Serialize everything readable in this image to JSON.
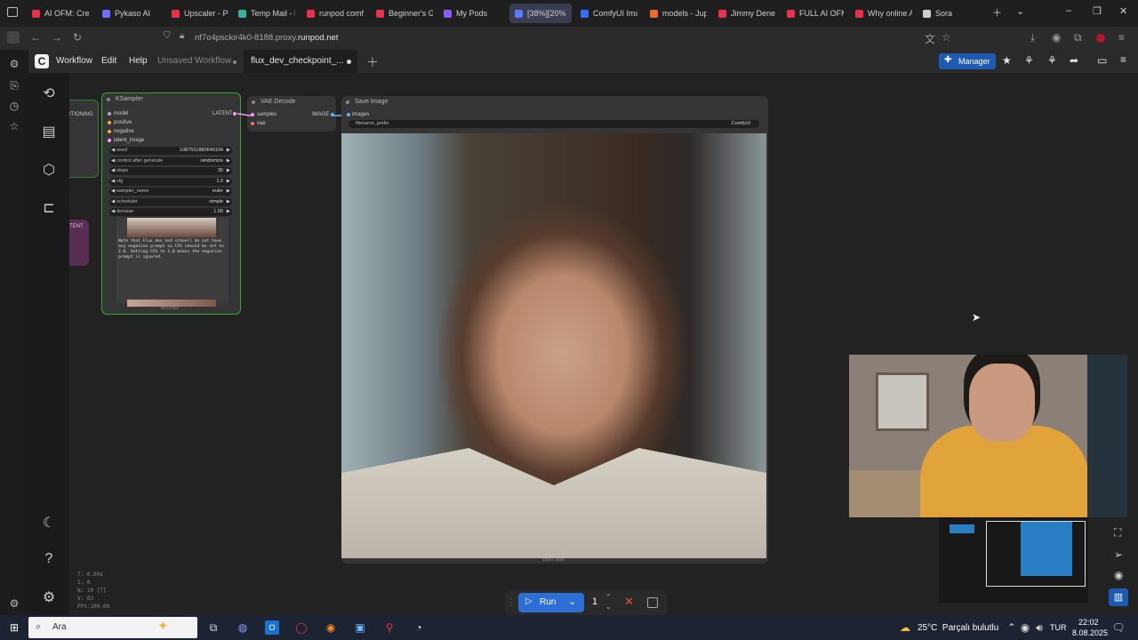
{
  "browser": {
    "tabs": [
      {
        "label": "AI OFM: Crea",
        "color": "#e8304f"
      },
      {
        "label": "Pykaso AI",
        "color": "#6d6dff"
      },
      {
        "label": "Upscaler - Py",
        "color": "#e8304f"
      },
      {
        "label": "Temp Mail - D",
        "color": "#3ab09e"
      },
      {
        "label": "runpod comfy",
        "color": "#e8304f"
      },
      {
        "label": "Beginner's Gu",
        "color": "#e8304f"
      },
      {
        "label": "My Pods",
        "color": "#8b5cf6"
      },
      {
        "label": "[38%][20%",
        "color": "#5b7cff"
      },
      {
        "label": "ComfyUI Imag",
        "color": "#3b6cff"
      },
      {
        "label": "models - Jupy",
        "color": "#e86a30"
      },
      {
        "label": "Jimmy Denero",
        "color": "#e8304f"
      },
      {
        "label": "FULL AI OFM",
        "color": "#e8304f"
      },
      {
        "label": "Why online AI",
        "color": "#e8304f"
      },
      {
        "label": "Sora",
        "color": "#cccccc"
      }
    ],
    "url_prefix": "nf7o4psckir4k0-8188.proxy.",
    "url_domain": "runpod.net"
  },
  "menu": {
    "workflow": "Workflow",
    "edit": "Edit",
    "help": "Help",
    "tab1": "Unsaved Workflow",
    "tab2": "flux_dev_checkpoint_...",
    "manager": "Manager"
  },
  "ksampler": {
    "title": "KSampler",
    "inputs": [
      "model",
      "positive",
      "negative",
      "latent_image"
    ],
    "output": "LATENT",
    "widgets": [
      {
        "k": "seed",
        "v": "1087551880640104"
      },
      {
        "k": "control after generate",
        "v": "randomize"
      },
      {
        "k": "steps",
        "v": "30"
      },
      {
        "k": "cfg",
        "v": "1.0"
      },
      {
        "k": "sampler_name",
        "v": "euler"
      },
      {
        "k": "scheduler",
        "v": "simple"
      },
      {
        "k": "denoise",
        "v": "1.00"
      }
    ],
    "note": "Note that Flux dev and schnell do not have any negative prompt so CFG should be set to 1.0. Setting CFG to 1.0 means the negative prompt is ignored.",
    "preview_size": "512 x 512"
  },
  "left_nodes": {
    "cond_label": "ITIONING",
    "latent_label": "TENT"
  },
  "vae": {
    "title": "VAE Decode",
    "inputs": [
      "samples",
      "vae"
    ],
    "output": "IMAGE"
  },
  "save": {
    "title": "Save Image",
    "input": "images",
    "prefix_key": "filename_prefix",
    "prefix_val": "ComfyUI",
    "image_size": "1024 x 1024"
  },
  "stats": {
    "t": "T: 0.00s",
    "i": "I: 0",
    "n": "N: 10 [7]",
    "v": "V: 83",
    "fps": "FPS:200.00"
  },
  "run": {
    "label": "Run",
    "count": "1"
  },
  "taskbar": {
    "search": "Ara",
    "weather": "25°C  Parçalı bulutlu",
    "lang": "TUR",
    "time": "22:02",
    "date": "8.08.2025"
  }
}
